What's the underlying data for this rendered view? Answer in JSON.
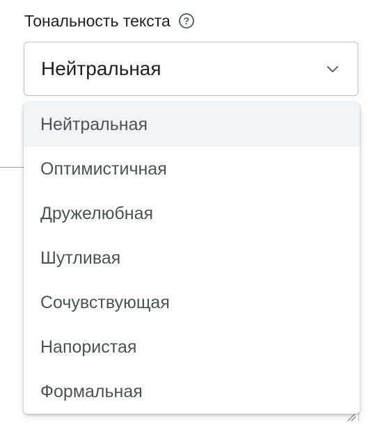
{
  "field": {
    "label": "Тональность текста",
    "help_icon": "question-circle-icon",
    "help_glyph": "?"
  },
  "select": {
    "value": "Нейтральная",
    "chevron_icon": "chevron-down-icon"
  },
  "dropdown": {
    "selected_index": 0,
    "options": [
      {
        "label": "Нейтральная"
      },
      {
        "label": "Оптимистичная"
      },
      {
        "label": "Дружелюбная"
      },
      {
        "label": "Шутливая"
      },
      {
        "label": "Сочувствующая"
      },
      {
        "label": "Напористая"
      },
      {
        "label": "Формальная"
      }
    ]
  },
  "colors": {
    "text": "#202124",
    "option_text": "#4d5156",
    "selected_bg": "#f1f3f4",
    "border": "#bdc1c6"
  }
}
